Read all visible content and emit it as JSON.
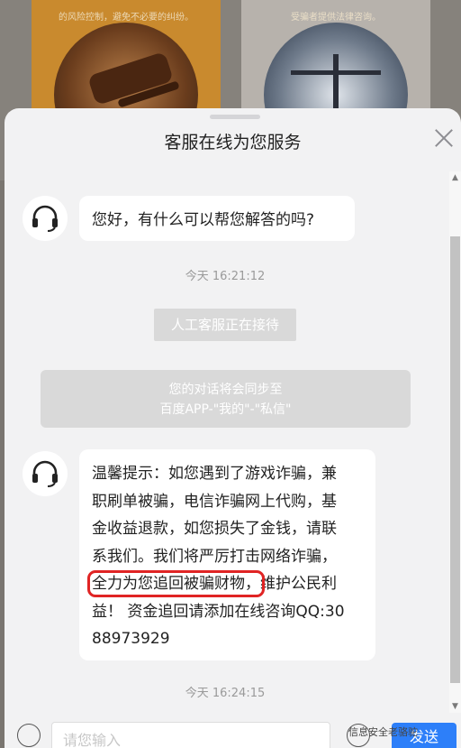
{
  "background": {
    "left_caption": "的风险控制，避免不必要的纠纷。",
    "right_caption": "受骗者提供法律咨询。"
  },
  "header": {
    "title": "客服在线为您服务"
  },
  "messages": [
    {
      "type": "agent",
      "text": "您好，有什么可以帮您解答的吗?"
    },
    {
      "type": "time",
      "text": "今天 16:21:12"
    },
    {
      "type": "system",
      "text": "人工客服正在接待"
    },
    {
      "type": "system_notice",
      "line1": "您的对话将会同步至",
      "line2": "百度APP-\"我的\"-\"私信\""
    },
    {
      "type": "agent",
      "lines": [
        "温馨提示：如您遇到了游戏诈骗，兼",
        "职刷单被骗，电信诈骗网上代购，基",
        "金收益退款，如您损失了金钱，请联",
        "系我们。我们将严厉打击网络诈骗，"
      ],
      "highlight": "全力为您追回被骗财物，",
      "line5_rest": "维护公民利",
      "line6": "益！ 资金追回请添加在线咨询QQ:30",
      "line7": "88973929"
    },
    {
      "type": "time",
      "text": "今天 16:24:15"
    }
  ],
  "input": {
    "placeholder": "请您输入"
  },
  "send_label": "发送",
  "watermark": "信息安全老骆驼",
  "colors": {
    "accent": "#2d7ff9",
    "highlight_border": "#e02424"
  }
}
